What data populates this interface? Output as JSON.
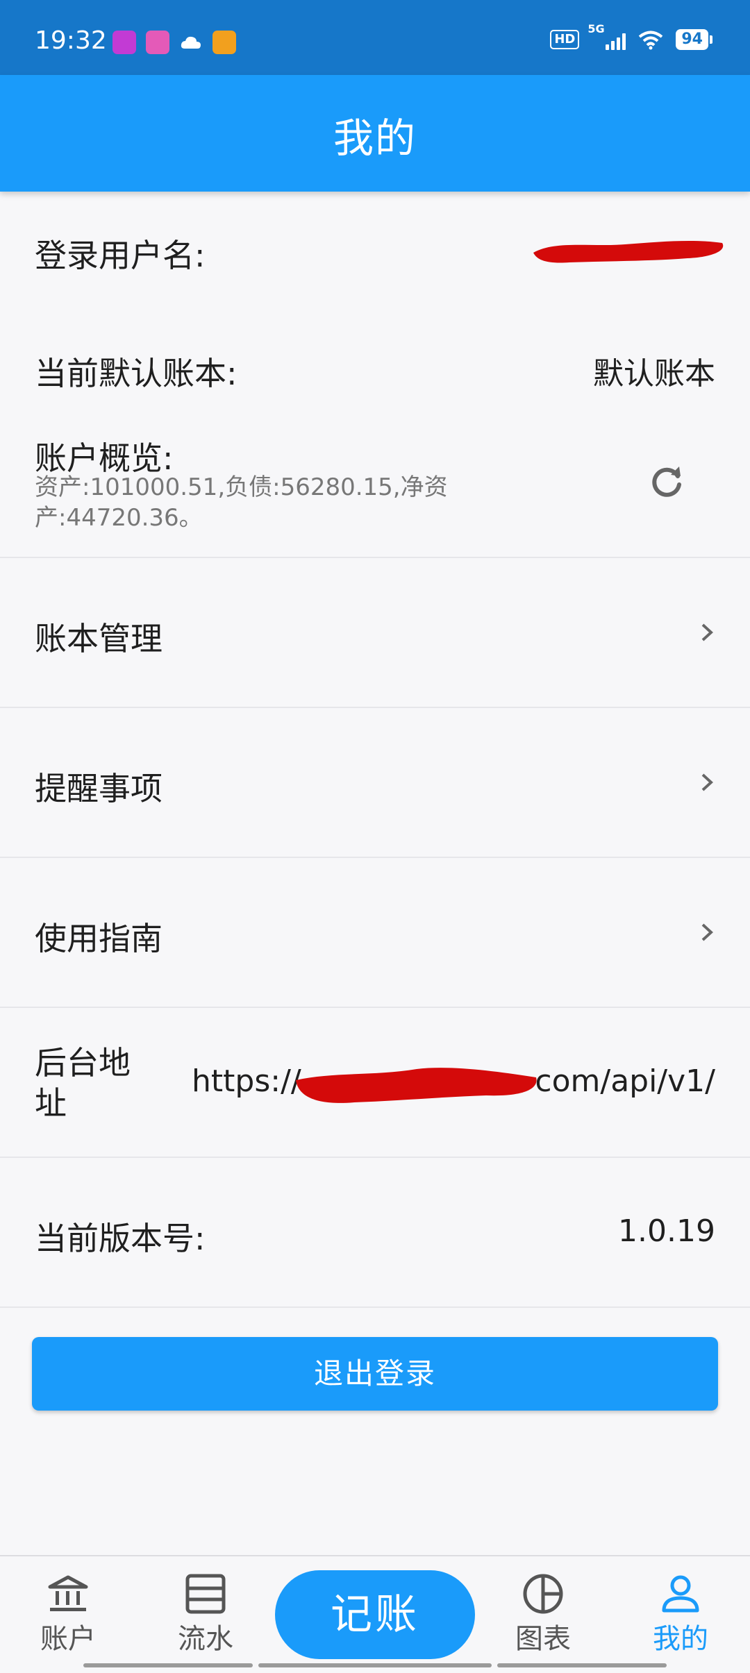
{
  "status_bar": {
    "time": "19:32",
    "network": "5G",
    "hd": "HD",
    "battery": "94"
  },
  "app_bar": {
    "title": "我的"
  },
  "profile": {
    "username_label": "登录用户名:",
    "ledger_label": "当前默认账本:",
    "ledger_value": "默认账本",
    "overview_label": "账户概览:",
    "overview_text": "资产:101000.51,负债:56280.15,净资产:44720.36。"
  },
  "menu": {
    "ledger_manage": "账本管理",
    "reminders": "提醒事项",
    "guide": "使用指南"
  },
  "server": {
    "label": "后台地址",
    "url_prefix": "https://",
    "url_suffix": "com/api/v1/"
  },
  "version": {
    "label": "当前版本号:",
    "value": "1.0.19"
  },
  "logout_label": "退出登录",
  "bottom_nav": {
    "accounts": "账户",
    "flow": "流水",
    "record": "记账",
    "charts": "图表",
    "mine": "我的"
  },
  "colors": {
    "primary": "#1a9bfa",
    "status_bar": "#1677c9",
    "redaction": "#d40a0a"
  }
}
